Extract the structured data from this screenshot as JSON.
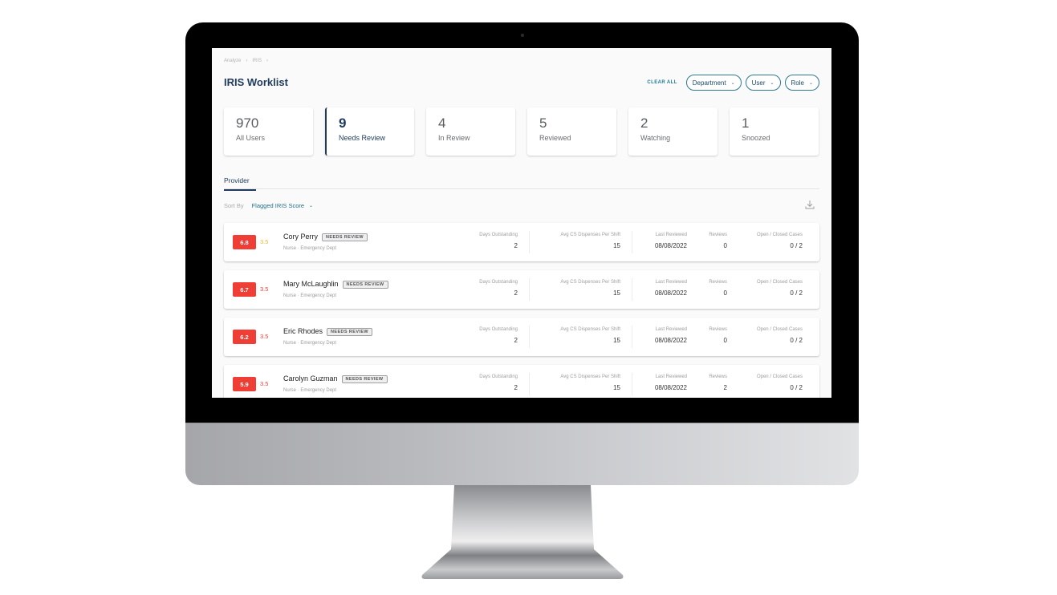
{
  "breadcrumb": [
    "Analyze",
    "IRIS"
  ],
  "breadcrumb_separator": "›",
  "page_title": "IRIS Worklist",
  "filters": {
    "clear_all": "CLEAR ALL",
    "items": [
      {
        "label": "Department"
      },
      {
        "label": "User"
      },
      {
        "label": "Role"
      }
    ],
    "chevron": "⌄"
  },
  "stats": [
    {
      "value": "970",
      "label": "All Users"
    },
    {
      "value": "9",
      "label": "Needs Review"
    },
    {
      "value": "4",
      "label": "In Review"
    },
    {
      "value": "5",
      "label": "Reviewed"
    },
    {
      "value": "2",
      "label": "Watching"
    },
    {
      "value": "1",
      "label": "Snoozed"
    }
  ],
  "tabs": [
    {
      "label": "Provider"
    }
  ],
  "sort": {
    "label": "Sort By",
    "value": "Flagged IRIS Score"
  },
  "columns": {
    "days": "Days Outstanding",
    "avg": "Avg CS Dispenses Per Shift",
    "last": "Last Reviewed",
    "reviews": "Reviews",
    "cases": "Open / Closed Cases"
  },
  "rows": [
    {
      "score": "6.8",
      "subscore": "3.5",
      "subscore_color": "#e8b730",
      "name": "Cory Perry",
      "badge": "NEEDS REVIEW",
      "role": "Nurse",
      "dept": "Emergency Dept",
      "days": "2",
      "avg": "15",
      "last": "08/08/2022",
      "reviews": "0",
      "cases": "0 / 2"
    },
    {
      "score": "6.7",
      "subscore": "3.5",
      "subscore_color": "#ee3e36",
      "name": "Mary McLaughlin",
      "badge": "NEEDS REVIEW",
      "role": "Nurse",
      "dept": "Emergency Dept",
      "days": "2",
      "avg": "15",
      "last": "08/08/2022",
      "reviews": "0",
      "cases": "0 / 2"
    },
    {
      "score": "6.2",
      "subscore": "3.5",
      "subscore_color": "#ee3e36",
      "name": "Eric Rhodes",
      "badge": "NEEDS REVIEW",
      "role": "Nurse",
      "dept": "Emergency Dept",
      "days": "2",
      "avg": "15",
      "last": "08/08/2022",
      "reviews": "0",
      "cases": "0 / 2"
    },
    {
      "score": "5.9",
      "subscore": "3.5",
      "subscore_color": "#ee3e36",
      "name": "Carolyn Guzman",
      "badge": "NEEDS REVIEW",
      "role": "Nurse",
      "dept": "Emergency Dept",
      "days": "2",
      "avg": "15",
      "last": "08/08/2022",
      "reviews": "2",
      "cases": "0 / 2"
    }
  ],
  "meta_separator": "·",
  "colors": {
    "primary": "#1e3a5f",
    "accent": "#1f7a94",
    "score_red": "#ee3e36"
  }
}
